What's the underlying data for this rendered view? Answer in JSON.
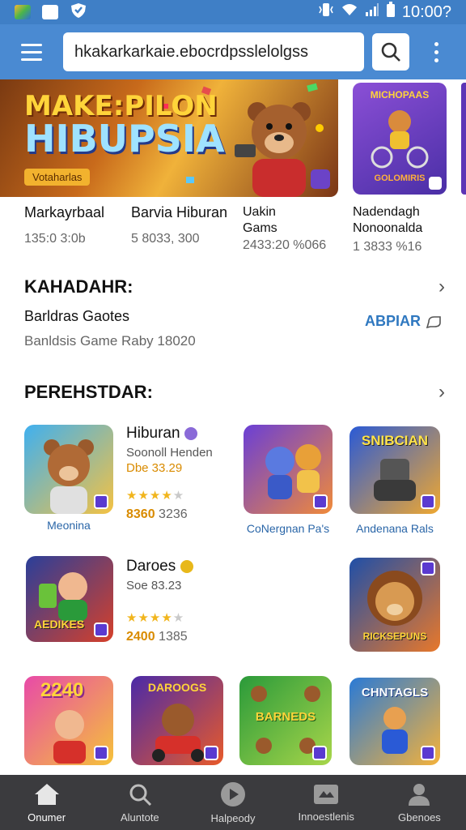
{
  "status_bar": {
    "time": "10:00?"
  },
  "search": {
    "value": "hkakarkarkaie.ebocrdpsslelolgss"
  },
  "banner": {
    "title_line1": "MAKE:PILON",
    "title_line2": "HIBUPSIA",
    "tag": "Votaharlas",
    "side_title": "MICHOPAAS",
    "side_bottom": "GOLOMIRIS"
  },
  "promos": [
    {
      "name": "Markayrbaal",
      "meta": "135:0 3:0b"
    },
    {
      "name": "Barvia Hiburan",
      "meta": "5 8033, 300"
    },
    {
      "name": "Uakin Gams",
      "meta": "2433:20 %066"
    },
    {
      "name": "Nadendagh Nonoonalda",
      "meta": "1 3833 %16"
    }
  ],
  "section1": {
    "title": "KAHADAHR:",
    "featured_name": "Barldras Gaotes",
    "featured_desc": "Banldsis Game Raby 18020",
    "cta": "ABPIAR"
  },
  "section2": {
    "title": "PEREHSTDAR:"
  },
  "apps": {
    "row1": {
      "caption1": "Meonina",
      "title": "Hiburan",
      "subtitle": "Soonoll Henden",
      "price": "Dbe 33.29",
      "stars": "★★★★",
      "stars_dim": "★",
      "count_bold": "8360",
      "count": "3236",
      "caption2": "CoNergnan Pa's",
      "caption3": "Andenana Rals",
      "tile3_text": "SNIBCIAN"
    },
    "row2": {
      "tile1_text": "AEDIKES",
      "title": "Daroes",
      "subtitle": "Soe 83.23",
      "stars": "★★★★",
      "stars_dim": "★",
      "count_bold": "2400",
      "count": "1385",
      "tile4_text": "RICKSEPUNS"
    },
    "row3": {
      "tile1_text": "2240",
      "tile2_text": "DAROOGS",
      "tile3_text": "BARNEDS",
      "tile4_text": "CHNTAGLS"
    }
  },
  "nav": [
    {
      "label": "Onumer"
    },
    {
      "label": "Aluntote"
    },
    {
      "label": "Halpeody"
    },
    {
      "label": "Innoestlenis"
    },
    {
      "label": "Gbenoes"
    }
  ],
  "colors": {
    "app_bar": "#4a8ad2",
    "status_bar": "#3f7fc6",
    "bottom_nav": "#3b3b3e",
    "link": "#2f78c0",
    "star": "#f1b51d"
  }
}
